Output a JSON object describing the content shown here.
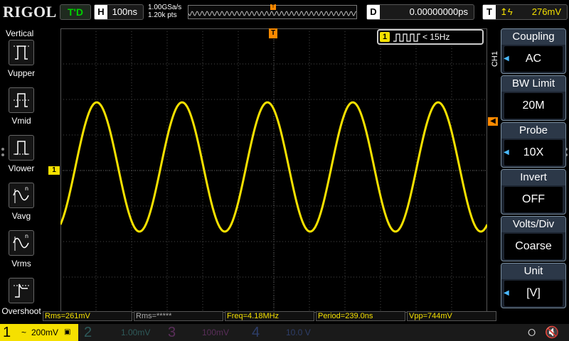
{
  "topbar": {
    "brand": "RIGOL",
    "trigger_status": "T'D",
    "horizontal_key": "H",
    "timebase": "100ns",
    "sample_rate": "1.00GSa/s",
    "memory_depth": "1.20k pts",
    "delay_key": "D",
    "delay_value": "0.00000000ps",
    "trigger_key": "T",
    "trigger_level": "276mV"
  },
  "left_menu": {
    "title": "Vertical",
    "items": [
      {
        "label": "Vupper",
        "icon": "vupper-icon"
      },
      {
        "label": "Vmid",
        "icon": "vmid-icon"
      },
      {
        "label": "Vlower",
        "icon": "vlower-icon"
      },
      {
        "label": "Vavg",
        "icon": "vavg-icon"
      },
      {
        "label": "Vrms",
        "icon": "vrms-icon"
      },
      {
        "label": "Overshoot",
        "icon": "overshoot-icon"
      }
    ]
  },
  "markers": {
    "ch1": "1",
    "trigger_position": "T"
  },
  "freq_counter": {
    "channel": "1",
    "value": "< 15Hz"
  },
  "right_menu": {
    "channel_label": "CH1",
    "items": [
      {
        "title": "Coupling",
        "value": "AC"
      },
      {
        "title": "BW Limit",
        "value": "20M"
      },
      {
        "title": "Probe",
        "value": "10X"
      },
      {
        "title": "Invert",
        "value": "OFF"
      },
      {
        "title": "Volts/Div",
        "value": "Coarse"
      },
      {
        "title": "Unit",
        "value": "[V]"
      }
    ]
  },
  "measurements": [
    "Rms=261mV",
    "Rms=*****",
    "Freq=4.18MHz",
    "Period=239.0ns",
    "Vpp=744mV"
  ],
  "channels": [
    {
      "num": "1",
      "scale": "200mV",
      "coupling": "~"
    },
    {
      "num": "2",
      "scale": "1.00mV"
    },
    {
      "num": "3",
      "scale": "100mV"
    },
    {
      "num": "4",
      "scale": "10.0 V"
    }
  ],
  "colors": {
    "ch1": "#f5e000",
    "trigger": "#ff8a00",
    "grid": "#4a4a4a",
    "menu_bg": "#1c2430"
  },
  "icons": {
    "usb": "usb-icon",
    "speaker": "speaker-muted-icon"
  }
}
